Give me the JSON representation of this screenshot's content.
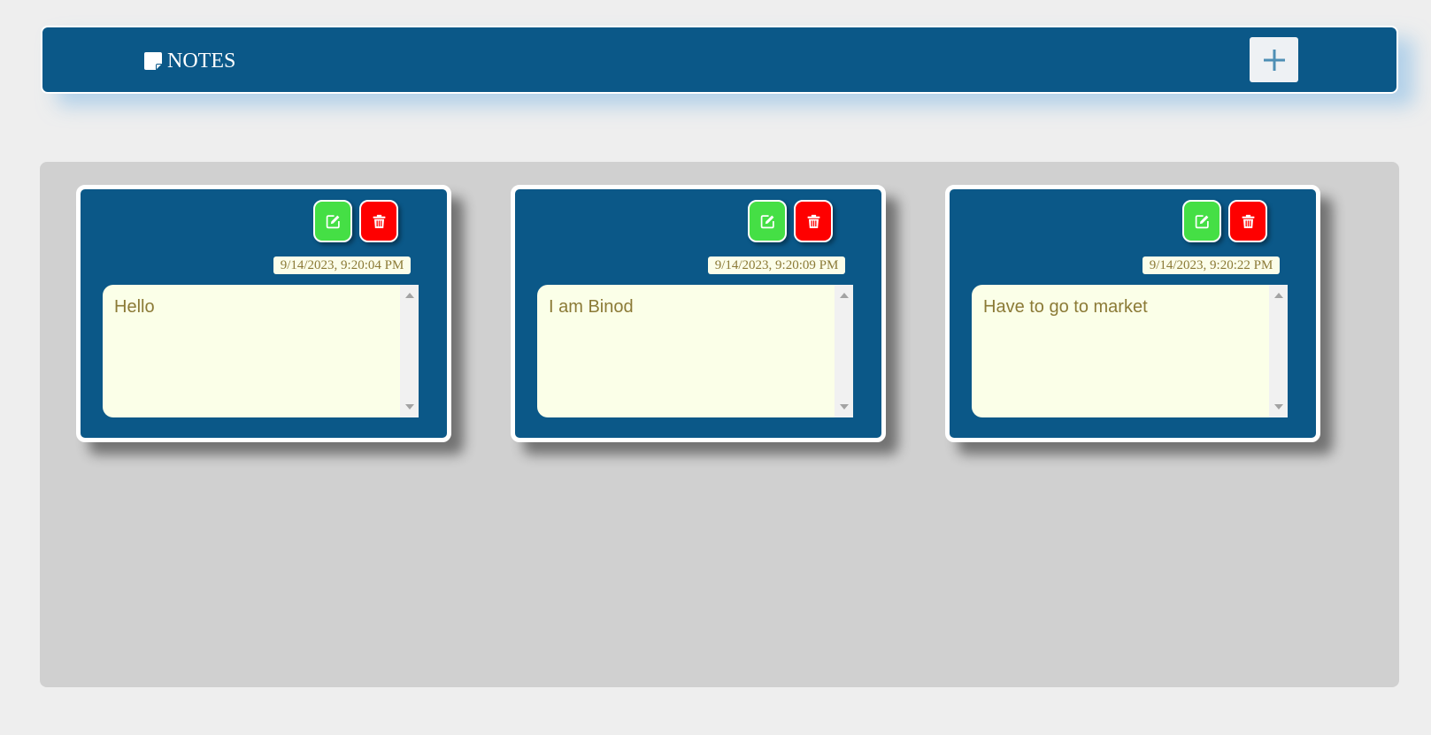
{
  "header": {
    "title": "NOTES",
    "brand_icon": "sticky-note-icon",
    "add_button_icon": "plus-icon",
    "colors": {
      "bar": "#0b5888",
      "add_button_bg": "#eef1f4",
      "plus": "#4e8fb5"
    }
  },
  "notes": [
    {
      "timestamp": "9/14/2023, 9:20:04 PM",
      "text": "Hello"
    },
    {
      "timestamp": "9/14/2023, 9:20:09 PM",
      "text": "I am Binod"
    },
    {
      "timestamp": "9/14/2023, 9:20:22 PM",
      "text": "Have to go to market"
    }
  ],
  "note_actions": {
    "edit_icon": "edit-icon",
    "delete_icon": "trash-icon",
    "edit_color": "#45df45",
    "delete_color": "#fe0000"
  },
  "colors": {
    "page_bg": "#eeeeee",
    "board_bg": "#d0d0d0",
    "card_bg": "#0b5888",
    "note_bg": "#fbffe8",
    "text": "#8b7a36"
  }
}
